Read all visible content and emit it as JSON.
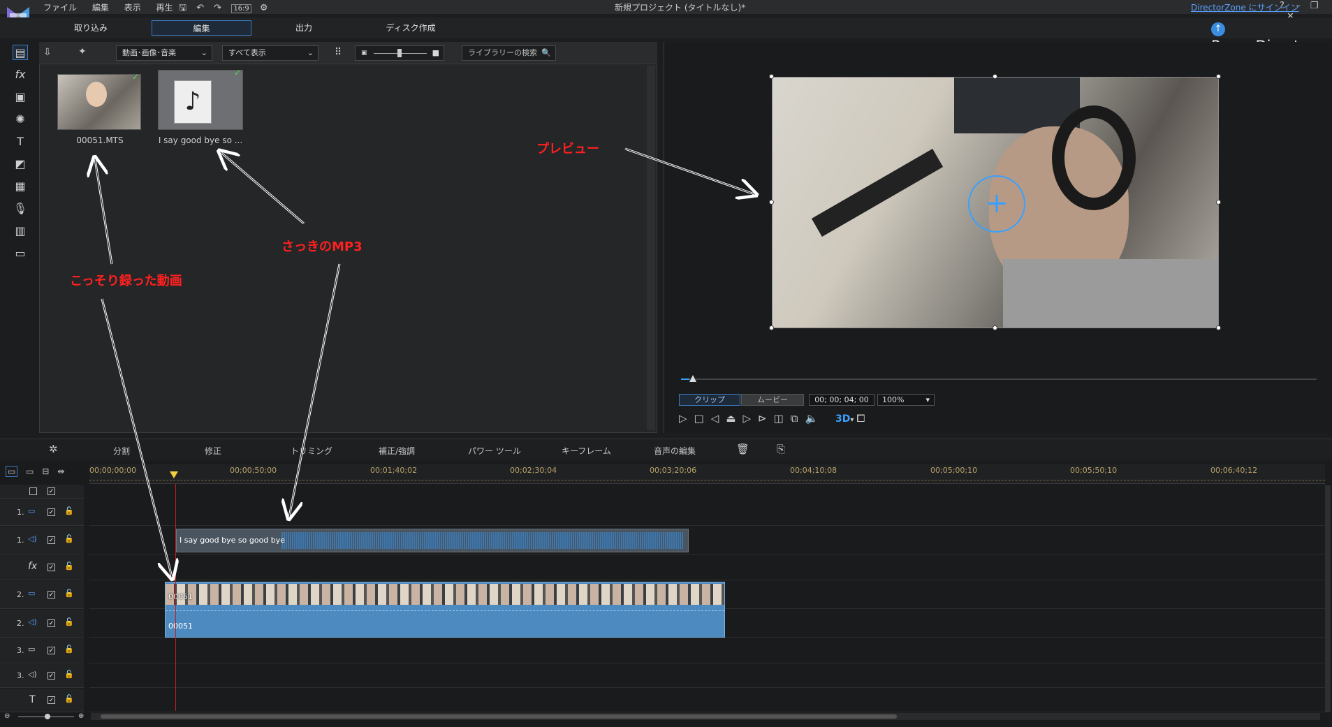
{
  "titlebar": {
    "menus": [
      "ファイル",
      "編集",
      "表示",
      "再生"
    ],
    "aspect": "16:9",
    "title": "新規プロジェクト (タイトルなし)*",
    "signin_link": "DirectorZone にサインイン",
    "help": "?"
  },
  "tabs": [
    "取り込み",
    "編集",
    "出力",
    "ディスク作成"
  ],
  "brand": "PowerDirector",
  "library": {
    "filter_media": "動画･画像･音楽",
    "filter_view": "すべて表示",
    "search_placeholder": "ライブラリーの検索",
    "items": [
      {
        "name": "00051.MTS",
        "type": "video"
      },
      {
        "name": "I say good bye so ...",
        "type": "audio"
      }
    ]
  },
  "preview": {
    "mode_clip": "クリップ",
    "mode_movie": "ムービー",
    "timecode": "00; 00; 04; 00",
    "zoom": "100%",
    "btn_3d": "3D"
  },
  "edit_tools": [
    "分割",
    "修正",
    "トリミング",
    "補正/強調",
    "パワー ツール",
    "キーフレーム",
    "音声の編集"
  ],
  "ruler_ticks": [
    "00;00;00;00",
    "00;00;50;00",
    "00;01;40;02",
    "00;02;30;04",
    "00;03;20;06",
    "00;04;10;08",
    "00;05;00;10",
    "00;05;50;10",
    "00;06;40;12"
  ],
  "tracks": [
    {
      "label": "1.",
      "kind": "video"
    },
    {
      "label": "1.",
      "kind": "audio"
    },
    {
      "label": "fx",
      "kind": "fx"
    },
    {
      "label": "2.",
      "kind": "video"
    },
    {
      "label": "2.",
      "kind": "audio"
    },
    {
      "label": "3.",
      "kind": "video"
    },
    {
      "label": "3.",
      "kind": "audio"
    },
    {
      "label": "T",
      "kind": "title"
    }
  ],
  "clips": {
    "audio1": "I say good bye so good bye",
    "video2": "00051",
    "audio2": "00051"
  },
  "annotations": {
    "preview": "プレビュー",
    "mp3": "さっきのMP3",
    "video": "こっそり録った動画"
  },
  "colors": {
    "annotation": "#ff2020",
    "accent": "#3e7cc0",
    "clip_video": "#4d8ac0"
  }
}
